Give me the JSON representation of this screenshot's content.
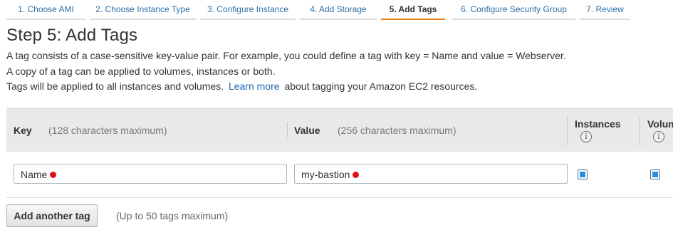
{
  "wizard_tabs": [
    {
      "label": "1. Choose AMI",
      "active": false
    },
    {
      "label": "2. Choose Instance Type",
      "active": false
    },
    {
      "label": "3. Configure Instance",
      "active": false
    },
    {
      "label": "4. Add Storage",
      "active": false
    },
    {
      "label": "5. Add Tags",
      "active": true
    },
    {
      "label": "6. Configure Security Group",
      "active": false
    },
    {
      "label": "7. Review",
      "active": false
    }
  ],
  "page": {
    "title": "Step 5: Add Tags",
    "desc_line1": "A tag consists of a case-sensitive key-value pair. For example, you could define a tag with key = Name and value = Webserver.",
    "desc_line2": "A copy of a tag can be applied to volumes, instances or both.",
    "desc_line3_pre": "Tags will be applied to all instances and volumes.",
    "learn_more": "Learn more",
    "desc_line3_post": "about tagging your Amazon EC2 resources."
  },
  "table": {
    "key_header": "Key",
    "key_hint": "(128 characters maximum)",
    "value_header": "Value",
    "value_hint": "(256 characters maximum)",
    "instances_header": "Instances",
    "volumes_header": "Volumes",
    "info_glyph": "i",
    "rows": [
      {
        "key": "Name",
        "value": "my-bastion",
        "instances": true,
        "volumes": true
      }
    ]
  },
  "actions": {
    "add_tag_label": "Add another tag",
    "add_tag_hint": "(Up to 50 tags maximum)"
  },
  "colors": {
    "tab_link": "#2b6ea6",
    "tab_active_underline": "#e8821e",
    "required_dot": "#e1111a",
    "checkbox_fill": "#2d8ed6"
  }
}
